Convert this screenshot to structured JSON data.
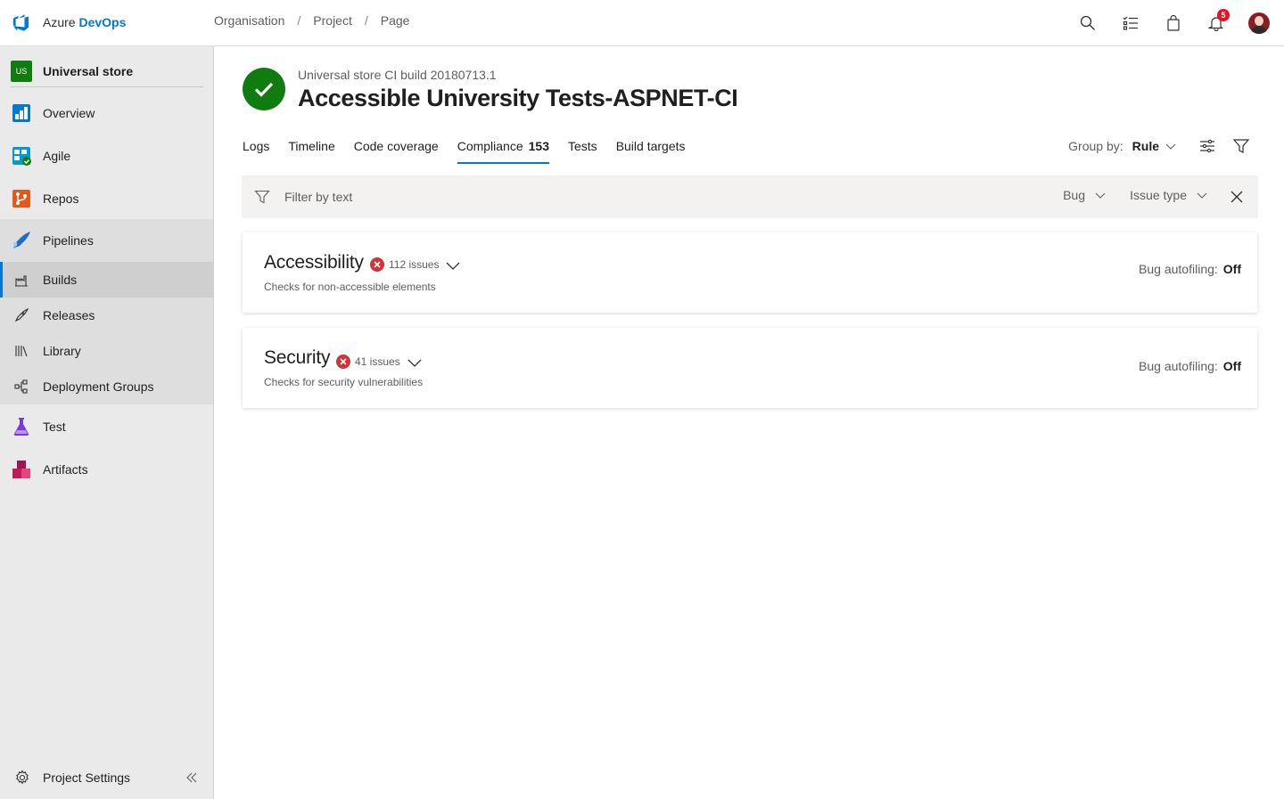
{
  "header": {
    "brand_prefix": "Azure",
    "brand_name": "DevOps",
    "breadcrumb": [
      "Organisation",
      "Project",
      "Page"
    ],
    "notification_count": "5"
  },
  "sidebar": {
    "project_initials": "US",
    "project_name": "Universal store",
    "items": [
      {
        "label": "Overview",
        "icon": "overview-icon"
      },
      {
        "label": "Agile",
        "icon": "agile-icon"
      },
      {
        "label": "Repos",
        "icon": "repos-icon"
      },
      {
        "label": "Pipelines",
        "icon": "pipelines-icon"
      },
      {
        "label": "Test",
        "icon": "test-icon"
      },
      {
        "label": "Artifacts",
        "icon": "artifacts-icon"
      }
    ],
    "pipeline_sub": [
      {
        "label": "Builds",
        "icon": "builds-icon",
        "selected": true
      },
      {
        "label": "Releases",
        "icon": "releases-icon"
      },
      {
        "label": "Library",
        "icon": "library-icon"
      },
      {
        "label": "Deployment Groups",
        "icon": "deployment-groups-icon"
      }
    ],
    "settings_label": "Project Settings"
  },
  "build": {
    "subtitle": "Universal store CI build 20180713.1",
    "title": "Accessible University Tests-ASPNET-CI",
    "status": "succeeded"
  },
  "tabs": {
    "logs": "Logs",
    "timeline": "Timeline",
    "code_coverage": "Code coverage",
    "compliance": "Compliance",
    "compliance_count": "153",
    "tests": "Tests",
    "build_targets": "Build targets",
    "active": "Compliance"
  },
  "group_by": {
    "label": "Group by:",
    "value": "Rule"
  },
  "filter": {
    "placeholder": "Filter by text",
    "dropdown_1": "Bug",
    "dropdown_2": "Issue type"
  },
  "cards": [
    {
      "title": "Accessibility",
      "issues": "112 issues",
      "description": "Checks for non-accessible elements",
      "autofiling_label": "Bug autofiling:",
      "autofiling_value": "Off"
    },
    {
      "title": "Security",
      "issues": "41 issues",
      "description": "Checks for security vulnerabilities",
      "autofiling_label": "Bug autofiling:",
      "autofiling_value": "Off"
    }
  ],
  "colors": {
    "accent": "#0078d4",
    "success": "#107c10",
    "error": "#d13438",
    "sidebar_bg": "#eaeaea"
  }
}
